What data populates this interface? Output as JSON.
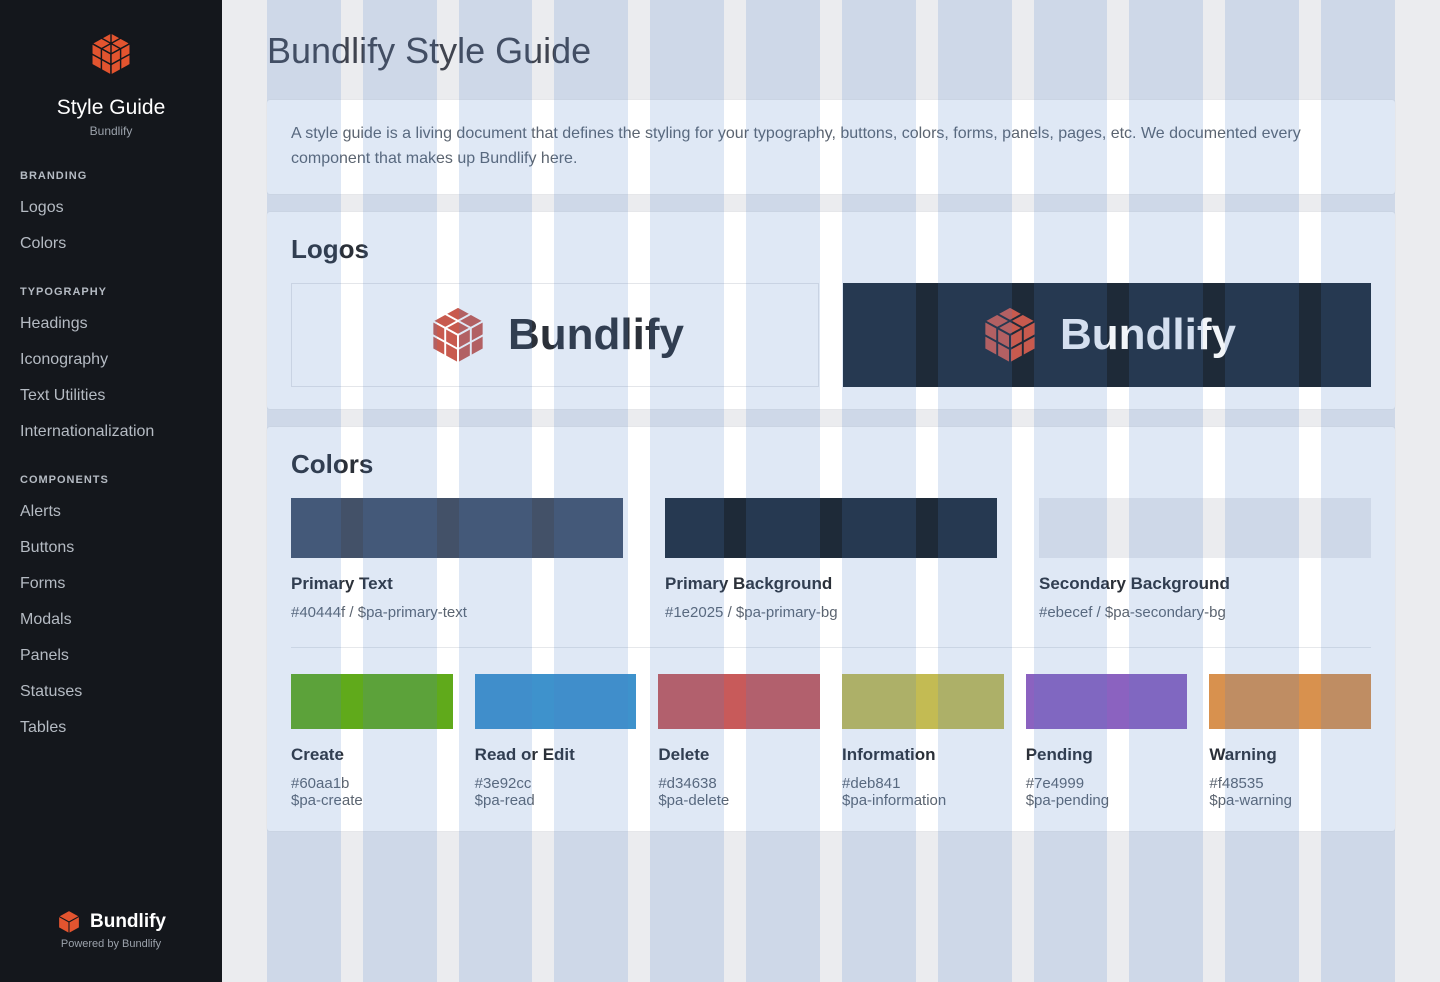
{
  "sidebar": {
    "title": "Style Guide",
    "subtitle": "Bundlify",
    "sections": [
      {
        "header": "BRANDING",
        "items": [
          "Logos",
          "Colors"
        ]
      },
      {
        "header": "TYPOGRAPHY",
        "items": [
          "Headings",
          "Iconography",
          "Text Utilities",
          "Internationalization"
        ]
      },
      {
        "header": "COMPONENTS",
        "items": [
          "Alerts",
          "Buttons",
          "Forms",
          "Modals",
          "Panels",
          "Statuses",
          "Tables"
        ]
      }
    ],
    "footer_brand": "Bundlify",
    "footer_sub": "Powered by Bundlify"
  },
  "page": {
    "title": "Bundlify Style Guide",
    "intro": "A style guide is a living document that defines the styling for your typography, buttons, colors, forms, panels, pages, etc. We documented every component that makes up Bundlify here."
  },
  "logos": {
    "heading": "Logos",
    "brand": "Bundlify"
  },
  "colors": {
    "heading": "Colors",
    "primary": [
      {
        "name": "Primary Text",
        "hex": "#40444f",
        "var": "$pa-primary-text",
        "swatch": "#435168"
      },
      {
        "name": "Primary Background",
        "hex": "#1e2025",
        "var": "$pa-primary-bg",
        "swatch": "#1e2a38"
      },
      {
        "name": "Secondary Background",
        "hex": "#ebecef",
        "var": "$pa-secondary-bg",
        "swatch": "#ebecef"
      }
    ],
    "utility": [
      {
        "name": "Create",
        "hex": "#60aa1b",
        "var": "$pa-create",
        "swatch": "#60aa1b"
      },
      {
        "name": "Read or Edit",
        "hex": "#3e92cc",
        "var": "$pa-read",
        "swatch": "#3e92cc"
      },
      {
        "name": "Delete",
        "hex": "#d34638",
        "var": "$pa-delete",
        "swatch": "#c85a5a"
      },
      {
        "name": "Information",
        "hex": "#deb841",
        "var": "$pa-information",
        "swatch": "#c3bb53"
      },
      {
        "name": "Pending",
        "hex": "#7e4999",
        "var": "$pa-pending",
        "swatch": "#8b62c0"
      },
      {
        "name": "Warning",
        "hex": "#f48535",
        "var": "$pa-warning",
        "swatch": "#d8914e"
      }
    ]
  },
  "brand_color": "#e2542f"
}
